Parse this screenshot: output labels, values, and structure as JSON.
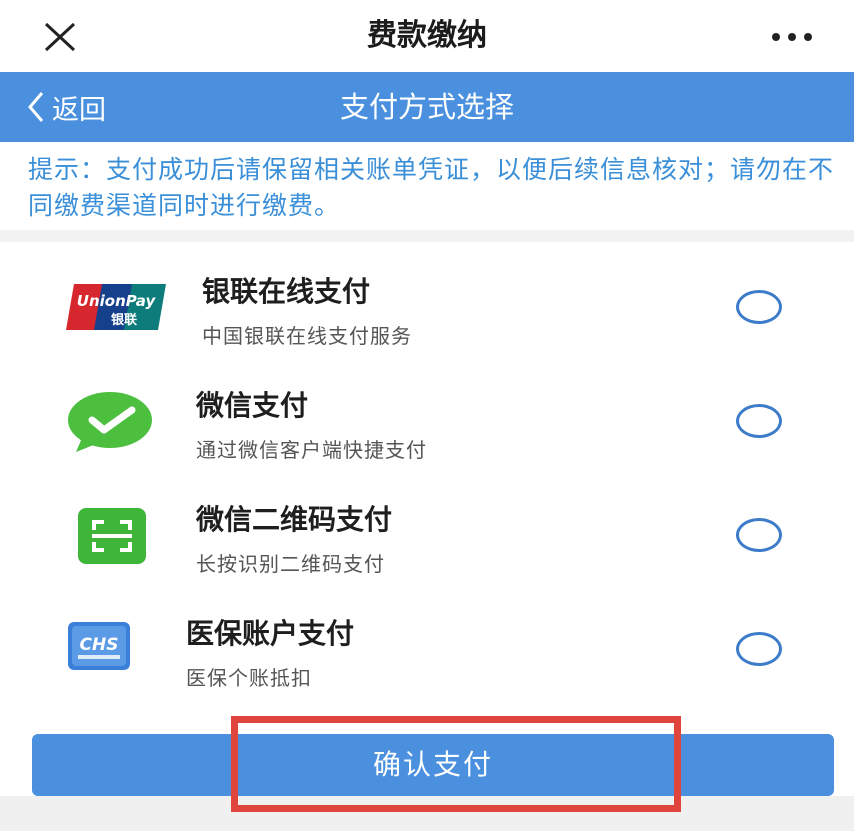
{
  "header": {
    "title": "费款缴纳",
    "close_icon": "close-icon",
    "more_icon": "more-horizontal-icon"
  },
  "nav": {
    "back_label": "返回",
    "title": "支付方式选择"
  },
  "notice": {
    "text": "提示：支付成功后请保留相关账单凭证，以便后续信息核对；请勿在不同缴费渠道同时进行缴费。"
  },
  "methods": [
    {
      "title": "银联在线支付",
      "desc": "中国银联在线支付服务",
      "icon": "unionpay-logo-icon",
      "logo_text": "UnionPay",
      "logo_subtext": "银联",
      "selected": false
    },
    {
      "title": "微信支付",
      "desc": "通过微信客户端快捷支付",
      "icon": "wechat-pay-icon",
      "selected": false
    },
    {
      "title": "微信二维码支付",
      "desc": "长按识别二维码支付",
      "icon": "qr-scan-icon",
      "selected": false
    },
    {
      "title": "医保账户支付",
      "desc": "医保个账抵扣",
      "icon": "chs-medical-insurance-icon",
      "logo_text": "CHS",
      "selected": false
    }
  ],
  "confirm": {
    "label": "确认支付"
  },
  "colors": {
    "primary": "#4a90de",
    "notice_text": "#3a8fd8",
    "radio_border": "#3d7cc9",
    "highlight": "#e0453d"
  }
}
